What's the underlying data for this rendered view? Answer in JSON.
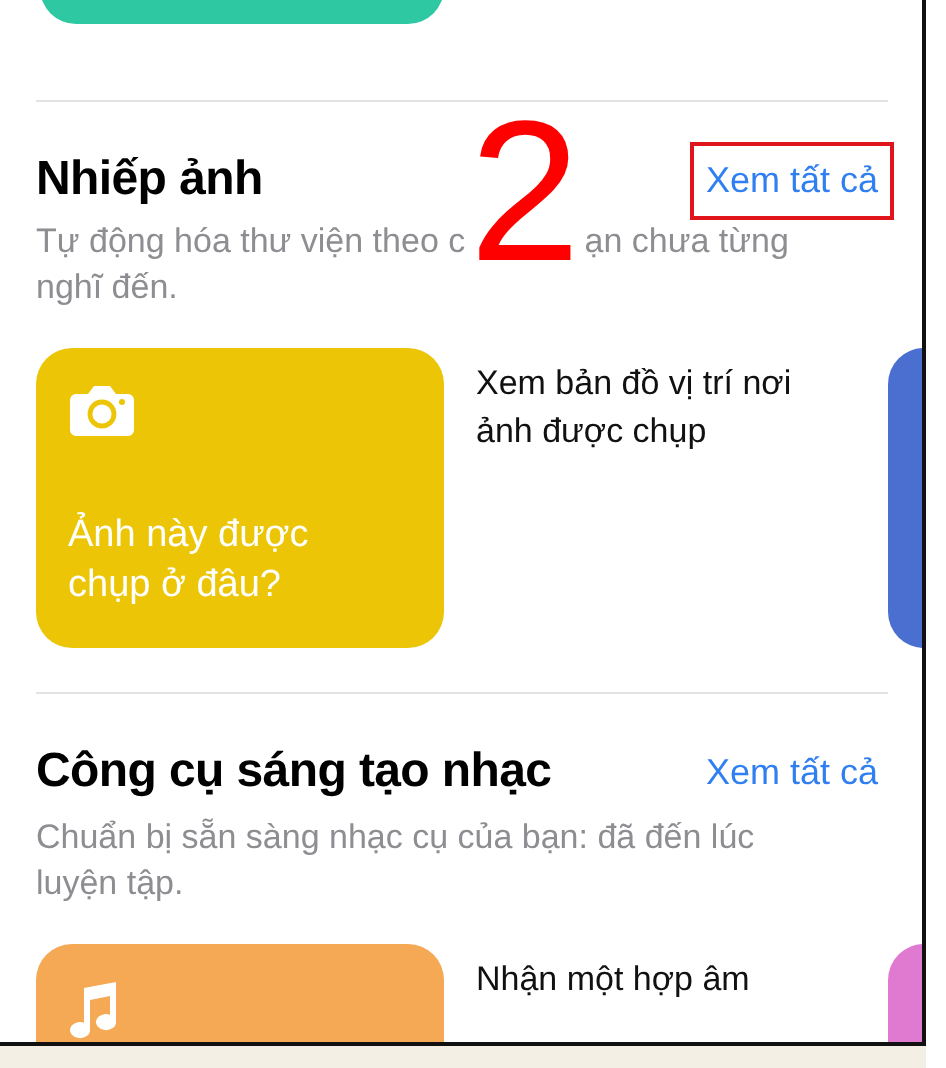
{
  "top_card": {
    "color": "#2ec9a2"
  },
  "sections": [
    {
      "title": "Nhiếp ảnh",
      "see_all": "Xem tất cả",
      "highlighted": true,
      "description_parts": [
        "Tự động hóa thư viện theo c",
        "ạn chưa từng",
        "nghĩ đến."
      ],
      "shortcuts": [
        {
          "kind": "camera",
          "title": "Ảnh này được chụp ở đâu?",
          "caption": "Xem bản đồ vị trí nơi ảnh được chụp",
          "color": "#ecc606"
        },
        {
          "color": "#4a6fd0"
        }
      ]
    },
    {
      "title": "Công cụ sáng tạo nhạc",
      "see_all": "Xem tất cả",
      "highlighted": false,
      "description": "Chuẩn bị sẵn sàng nhạc cụ của bạn: đã đến lúc luyện tập.",
      "shortcuts": [
        {
          "kind": "music",
          "caption": "Nhận một hợp âm",
          "color": "#f5a955"
        },
        {
          "color": "#e07ad0"
        }
      ]
    }
  ],
  "annotation": {
    "number": "2"
  }
}
